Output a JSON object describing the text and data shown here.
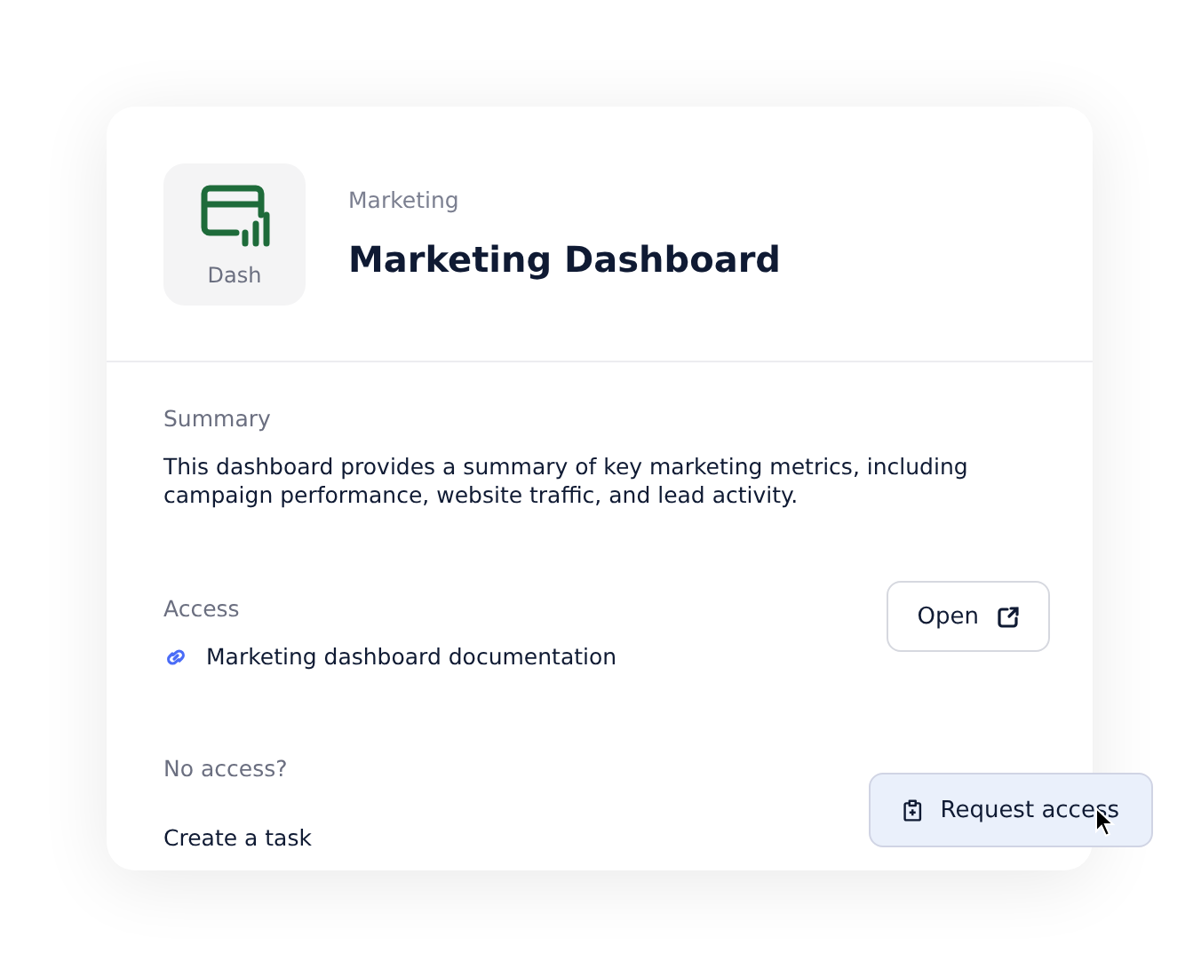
{
  "header": {
    "icon_label": "Dash",
    "category": "Marketing",
    "title": "Marketing Dashboard"
  },
  "summary": {
    "label": "Summary",
    "text": "This dashboard provides a summary of key marketing metrics, including campaign performance, website traffic, and lead activity."
  },
  "access": {
    "label": "Access",
    "link": "Marketing dashboard documentation",
    "button": "Open"
  },
  "no_access": {
    "label": "No access?",
    "text": "Create a task",
    "button": "Request access",
    "hovered": true
  }
}
